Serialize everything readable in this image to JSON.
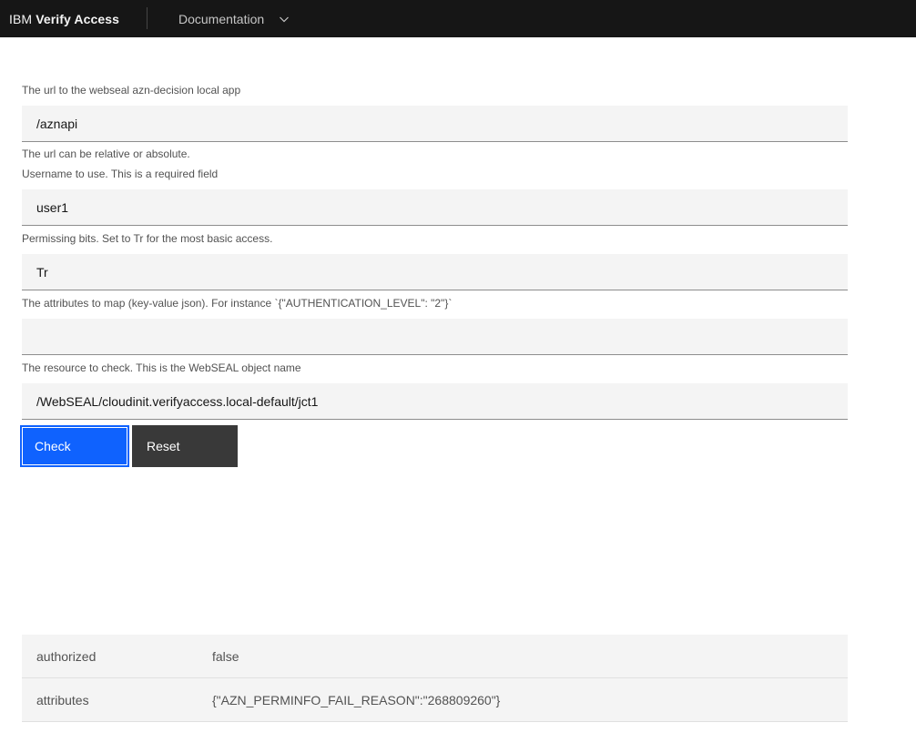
{
  "header": {
    "brand_prefix": "IBM",
    "brand_name": "Verify Access",
    "nav_item": "Documentation",
    "icons": {
      "nav_chevron": "chevron-down-icon"
    },
    "colors": {
      "background": "#161616",
      "text": "#f4f4f4",
      "nav_text": "#c6c6c6"
    }
  },
  "form": {
    "fields": [
      {
        "label": "The url to the webseal azn-decision local app",
        "value": "/aznapi",
        "helper": "The url can be relative or absolute."
      },
      {
        "label": "Username to use. This is a required field",
        "value": "user1",
        "helper": ""
      },
      {
        "label": "Permissing bits. Set to Tr for the most basic access.",
        "value": "Tr",
        "helper": ""
      },
      {
        "label": "The attributes to map (key-value json). For instance `{\"AUTHENTICATION_LEVEL\": \"2\"}`",
        "value": "",
        "helper": ""
      },
      {
        "label": "The resource to check. This is the WebSEAL object name",
        "value": "/WebSEAL/cloudinit.verifyaccess.local-default/jct1",
        "helper": ""
      }
    ],
    "buttons": {
      "check": "Check",
      "reset": "Reset"
    },
    "colors": {
      "input_background": "#f4f4f4",
      "input_border_bottom": "#8d8d8d",
      "label_text": "#525252",
      "primary_button": "#0f62fe",
      "secondary_button": "#393939"
    }
  },
  "results": {
    "rows": [
      {
        "key": "authorized",
        "value": "false"
      },
      {
        "key": "attributes",
        "value": "{\"AZN_PERMINFO_FAIL_REASON\":\"268809260\"}"
      }
    ],
    "colors": {
      "row_background": "#f4f4f4",
      "divider": "#e0e0e0",
      "text": "#525252"
    }
  }
}
